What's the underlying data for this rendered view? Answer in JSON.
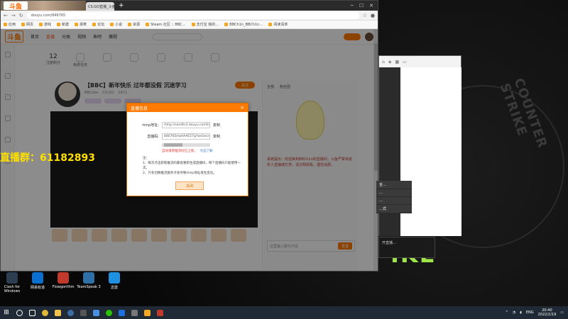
{
  "overlay": {
    "stream_group": "直播群：61182893"
  },
  "browser": {
    "tab_label": "CS:GO直播_斗鱼…",
    "logo_text": "斗鱼",
    "tab_new": "+",
    "url": "douyu.com/846765",
    "bookmarks": [
      "应用",
      "网页",
      "游戏",
      "新建",
      "搞笑",
      "论坛",
      "小说",
      "资源",
      "Steam 社区 :: BBC…",
      "支付宝 我的…",
      "BBCh1n_BBCh1n…",
      "阅读清单"
    ]
  },
  "douyu": {
    "logo": "斗鱼",
    "nav": [
      "首页",
      "直播",
      "分类",
      "视频",
      "鱼吧",
      "赛程"
    ],
    "categories": [
      {
        "num": "12",
        "label": "注册积分"
      },
      {
        "num": "",
        "label": "免费任务"
      },
      {
        "num": "",
        "label": ""
      },
      {
        "num": "",
        "label": ""
      },
      {
        "num": "",
        "label": ""
      },
      {
        "num": "",
        "label": ""
      },
      {
        "num": "",
        "label": ""
      }
    ],
    "room_title": "【BBC】新年快乐 过年都没假 沉迷学习",
    "room_meta": [
      "BBCbbs",
      "CS:GO",
      "1871"
    ],
    "follow": "关注",
    "chat_tabs": [
      "全部",
      "粉丝团"
    ],
    "chat_notice": "系统提示：欢迎来到BBCh1n的直播间，斗鱼严禁未成年人直播或打赏，请文明观看，理性消费。",
    "chat_placeholder": "这里输入聊天内容",
    "send": "发送"
  },
  "modal": {
    "title": "直播信息",
    "close": "×",
    "rtmp_label": "rtmp地址:",
    "rtmp_value": "rtmp://sendtc3.douyu.com/live",
    "copy_label": "复制",
    "key_label": "直播码:",
    "key_value": "846765rIwXAAE57g?wsSecret=**********",
    "warn": "自动请求推流码已上线，",
    "link": "点击了解",
    "notes_title": "注：",
    "note1": "1、每次点击获取推流码都会重新生成直播码，每个直播码只能使用一次。",
    "note2": "2、只有切换推流服务才会导致rtmp地址发生变化。",
    "confirm": "关闭"
  },
  "win2": {
    "menu": [
      "全…",
      "…",
      "…",
      "…式"
    ],
    "note": "开直播…"
  },
  "desktop_icons": [
    {
      "label": "Clash for Windows",
      "color": "#2c3e50"
    },
    {
      "label": "网易有道",
      "color": "#0b6fcf"
    },
    {
      "label": "Flowgorithm",
      "color": "#c0392b"
    },
    {
      "label": "TeamSpeak 3",
      "color": "#2e6fa8"
    },
    {
      "label": "迅雷",
      "color": "#1f8fe0"
    }
  ],
  "taskbar": {
    "lang": "ENG",
    "time": "20:40",
    "date": "2022/2/19"
  },
  "colors": {
    "accent": "#ff7a00",
    "overlay_text": "#ffe000",
    "cs_green": "#9fe54a"
  }
}
